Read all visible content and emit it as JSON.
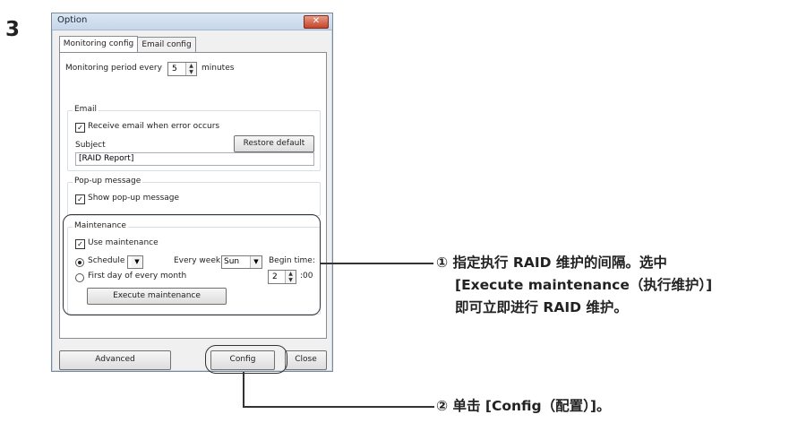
{
  "step_number": "3",
  "window": {
    "title": "Option",
    "close_glyph": "✕",
    "tabs": [
      "Monitoring config",
      "Email config"
    ],
    "monitoring": {
      "prefix": "Monitoring period every",
      "value": "5",
      "suffix": "minutes"
    },
    "email": {
      "group_label": "Email",
      "checkbox_label": "Receive email when error occurs",
      "subject_label": "Subject",
      "restore_button": "Restore default",
      "subject_value": "[RAID Report]"
    },
    "popup": {
      "group_label": "Pop-up message",
      "checkbox_label": "Show pop-up message"
    },
    "maintenance": {
      "group_label": "Maintenance",
      "use_label": "Use maintenance",
      "schedule_label": "Schedule",
      "every_week_label": "Every week",
      "day_value": "Sun",
      "begin_time_label": "Begin time:",
      "first_day_label": "First day of every month",
      "hour_value": "2",
      "minutes_suffix": ":00",
      "execute_button": "Execute maintenance"
    },
    "bottom": {
      "advanced": "Advanced",
      "config": "Config",
      "close": "Close"
    }
  },
  "annotations": {
    "note1_line1": "① 指定执行 RAID 维护的间隔。选中",
    "note1_line2": "[Execute maintenance（执行维护）]",
    "note1_line3": "即可立即进行 RAID 维护。",
    "note2": "② 单击 [Config（配置）]。"
  }
}
